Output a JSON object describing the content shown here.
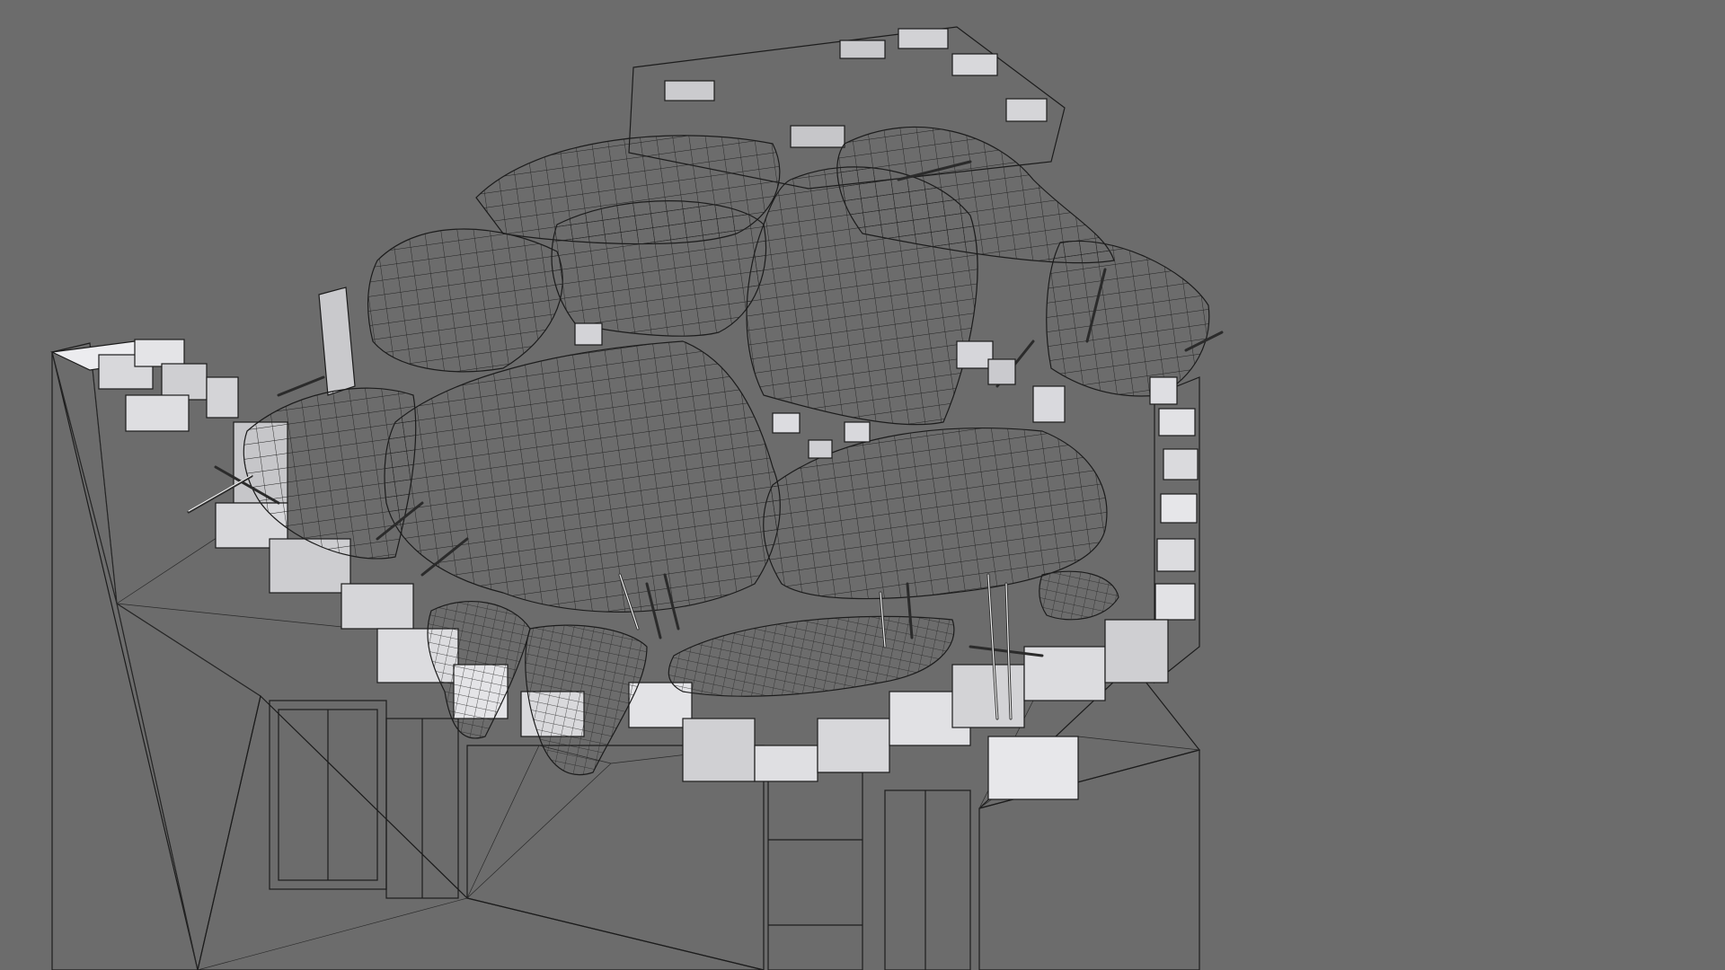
{
  "viewport": {
    "background_color": "#6c6c6c",
    "display_mode": "wireframe-on-shaded",
    "subject": "damaged-building-with-rubble-mesh"
  },
  "colors": {
    "building_face_light": "#d9d9dc",
    "building_face_mid": "#a9a9ac",
    "building_face_dark": "#8c8c8f",
    "rubble_light": "#f2f2f5",
    "rubble_shadow": "#bdbdc2",
    "wire": "#1c1c1c"
  }
}
